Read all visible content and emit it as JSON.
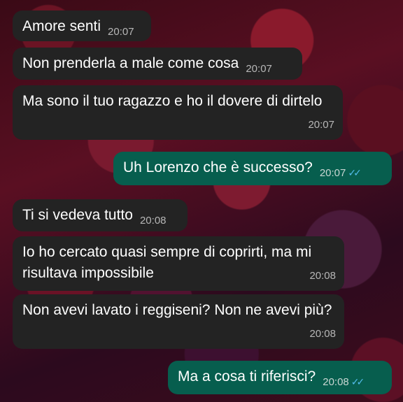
{
  "messages": [
    {
      "direction": "in",
      "text": "Amore senti",
      "time": "20:07"
    },
    {
      "direction": "in",
      "text": "Non prenderla a male come cosa",
      "time": "20:07"
    },
    {
      "direction": "in",
      "text": "Ma sono il tuo ragazzo e ho il dovere di dirtelo",
      "time": "20:07"
    },
    {
      "direction": "out",
      "text": "Uh Lorenzo che è successo?",
      "time": "20:07",
      "status_icon": "double-check-icon"
    },
    {
      "direction": "in",
      "text": "Ti si vedeva tutto",
      "time": "20:08"
    },
    {
      "direction": "in",
      "text": "Io ho cercato quasi sempre di coprirti, ma mi risultava impossibile",
      "time": "20:08"
    },
    {
      "direction": "in",
      "text": "Non avevi lavato i reggiseni? Non ne avevi più?",
      "time": "20:08"
    },
    {
      "direction": "out",
      "text": "Ma a cosa ti riferisci?",
      "time": "20:08",
      "status_icon": "double-check-icon"
    }
  ],
  "colors": {
    "incoming_bubble": "#232323",
    "outgoing_bubble": "#075e4e",
    "read_check": "#53bdeb"
  }
}
